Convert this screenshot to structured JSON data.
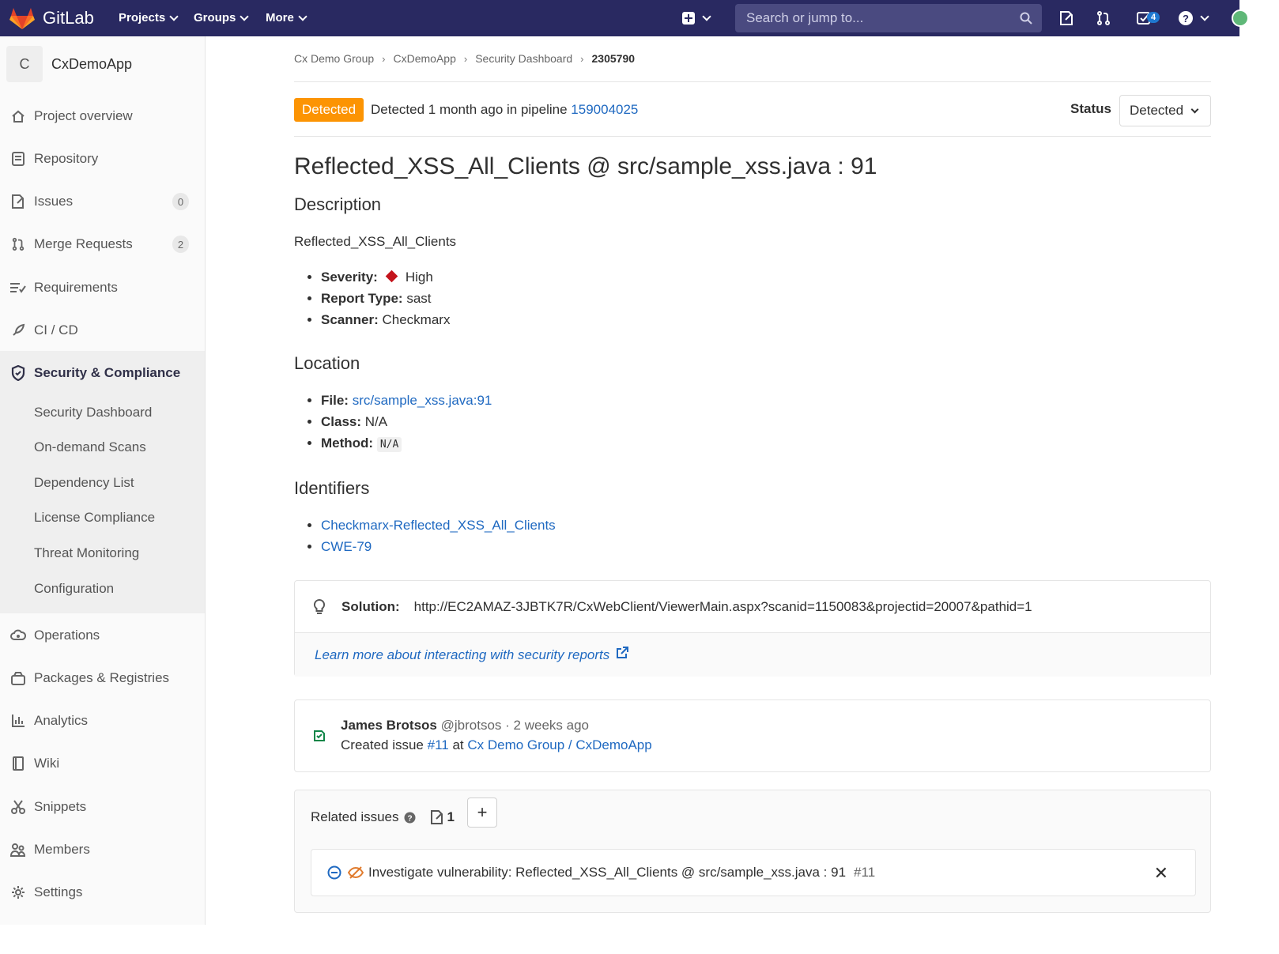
{
  "topnav": {
    "brand": "GitLab",
    "menu": [
      {
        "label": "Projects"
      },
      {
        "label": "Groups"
      },
      {
        "label": "More"
      }
    ],
    "search_placeholder": "Search or jump to...",
    "todo_count": "4"
  },
  "sidebar": {
    "project_initial": "C",
    "project_name": "CxDemoApp",
    "items": [
      {
        "label": "Project overview",
        "icon": "home-icon"
      },
      {
        "label": "Repository",
        "icon": "document-icon"
      },
      {
        "label": "Issues",
        "icon": "issues-icon",
        "count": "0"
      },
      {
        "label": "Merge Requests",
        "icon": "merge-request-icon",
        "count": "2"
      },
      {
        "label": "Requirements",
        "icon": "requirements-icon"
      },
      {
        "label": "CI / CD",
        "icon": "rocket-icon"
      },
      {
        "label": "Security & Compliance",
        "icon": "shield-icon"
      },
      {
        "label": "Operations",
        "icon": "cloud-gear-icon"
      },
      {
        "label": "Packages & Registries",
        "icon": "package-icon"
      },
      {
        "label": "Analytics",
        "icon": "chart-icon"
      },
      {
        "label": "Wiki",
        "icon": "book-icon"
      },
      {
        "label": "Snippets",
        "icon": "scissors-icon"
      },
      {
        "label": "Members",
        "icon": "users-icon"
      },
      {
        "label": "Settings",
        "icon": "gear-icon"
      }
    ],
    "security_sub": [
      "Security Dashboard",
      "On-demand Scans",
      "Dependency List",
      "License Compliance",
      "Threat Monitoring",
      "Configuration"
    ]
  },
  "breadcrumbs": [
    "Cx Demo Group",
    "CxDemoApp",
    "Security Dashboard",
    "2305790"
  ],
  "header": {
    "badge": "Detected",
    "detected_text": "Detected 1 month ago in pipeline ",
    "pipeline_link": "159004025",
    "status_label": "Status",
    "status_value": "Detected"
  },
  "vulnerability": {
    "title": "Reflected_XSS_All_Clients @ src/sample_xss.java : 91",
    "description_heading": "Description",
    "description": "Reflected_XSS_All_Clients",
    "details": {
      "severity_label": "Severity:",
      "severity_value": "High",
      "report_type_label": "Report Type:",
      "report_type_value": "sast",
      "scanner_label": "Scanner:",
      "scanner_value": "Checkmarx"
    },
    "location_heading": "Location",
    "location": {
      "file_label": "File:",
      "file_value": "src/sample_xss.java:91",
      "class_label": "Class:",
      "class_value": "N/A",
      "method_label": "Method:",
      "method_value": "N/A"
    },
    "identifiers_heading": "Identifiers",
    "identifiers": [
      "Checkmarx-Reflected_XSS_All_Clients",
      "CWE-79"
    ],
    "solution_label": "Solution:",
    "solution_value": "http://EC2AMAZ-3JBTK7R/CxWebClient/ViewerMain.aspx?scanid=1150083&projectid=20007&pathid=1",
    "learn_more": "Learn more about interacting with security reports"
  },
  "activity": {
    "author": "James Brotsos",
    "handle": "@jbrotsos",
    "time": " · 2 weeks ago",
    "action_prefix": "Created issue ",
    "issue_ref": "#11",
    "at_text": " at ",
    "project_path": "Cx Demo Group / CxDemoApp"
  },
  "related": {
    "heading": "Related issues",
    "count": "1",
    "add_label": "+",
    "item_title": "Investigate vulnerability: Reflected_XSS_All_Clients @ src/sample_xss.java : 91",
    "item_ref": "#11"
  },
  "colors": {
    "nav_bg": "#292961",
    "badge_orange": "#fc9403",
    "link_blue": "#1f69c1",
    "severity_red": "#c4141c",
    "activity_green": "#108548"
  }
}
